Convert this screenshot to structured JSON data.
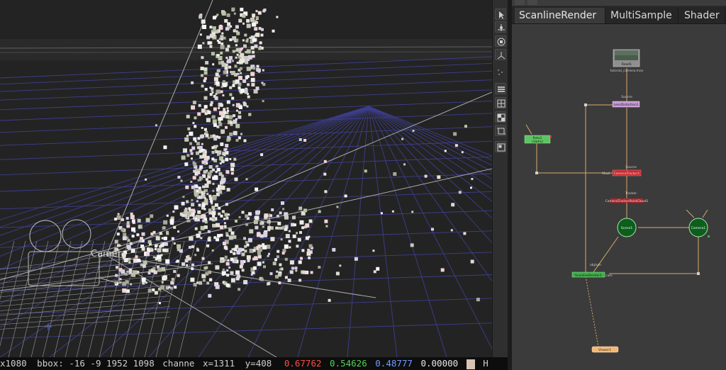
{
  "info_bar": {
    "format": "x1080",
    "bbox": "bbox: -16 -9 1952 1098",
    "channels": "channe",
    "x": "x=1311",
    "y": "y=408",
    "r": "0.67762",
    "g": "0.54626",
    "b": "0.48777",
    "a": "0.00000",
    "channel_letter": "H"
  },
  "viewer": {
    "camera_label": "Camera"
  },
  "toolbar": {
    "icons": [
      "pointer-icon",
      "translate-icon",
      "scale-icon",
      "rotate-icon",
      "points-icon",
      "render-lines-icon",
      "grid-icon",
      "checker-icon",
      "frame-icon",
      "snap-icon"
    ]
  },
  "tabs": [
    "ScanlineRender",
    "MultiSample",
    "Shader"
  ],
  "nodes": {
    "read": "Read1",
    "read_sub": "tutorial_camera.mov",
    "source_label": "Source",
    "lens_distortion": "LensDistortion1",
    "roto": "Roto1",
    "roto_sub": "(alpha)",
    "mask_label": "Mask",
    "camera_tracker": "CameraTracker1",
    "tracker_label": "Tracker",
    "point_cloud": "CameraTrackerPointCloud1",
    "scene": "Scene1",
    "camera": "Camera1",
    "scanline": "ScanlineRender1",
    "obj_scn": "obj/scn",
    "cam_label": "cam",
    "viewer": "Viewer1"
  },
  "colors": {
    "accent_red": "#e8706a",
    "accent_green": "#56b865",
    "accent_blue": "#6a9cf0",
    "read_node": "#8f8f8f",
    "lens_node": "#c89bd6",
    "roto_node": "#5ec462",
    "tracker_node": "#c8282d",
    "scene_node": "#0d5e1c",
    "scanline_node": "#3fae4a",
    "viewer_node": "#f3b877"
  }
}
